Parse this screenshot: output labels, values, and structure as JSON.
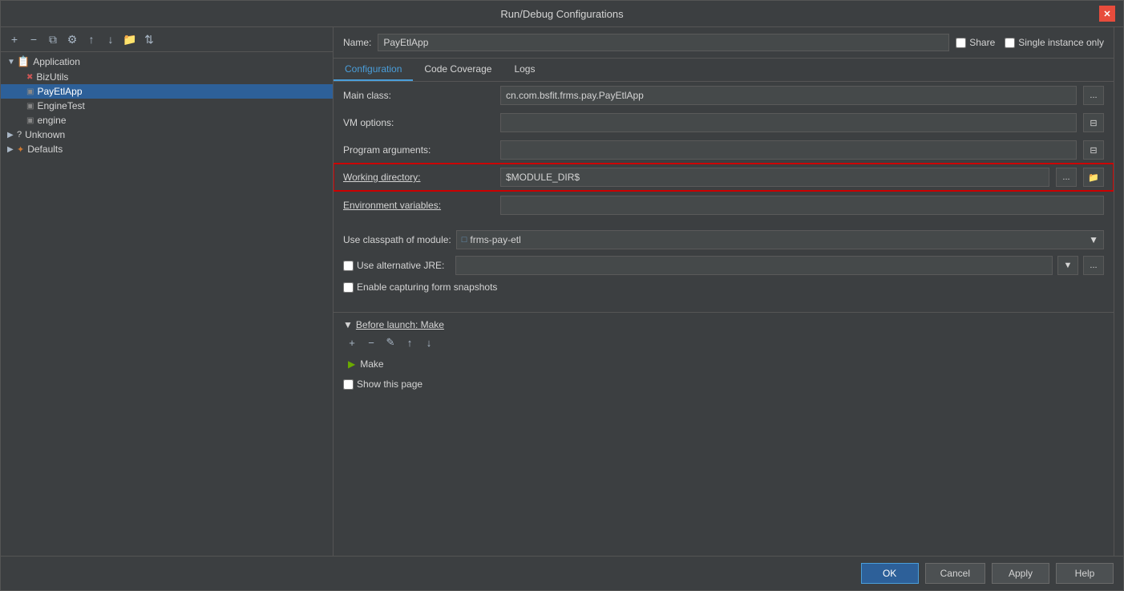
{
  "dialog": {
    "title": "Run/Debug Configurations"
  },
  "header": {
    "name_label": "Name:",
    "name_value": "PayEtlApp",
    "share_label": "Share",
    "single_instance_label": "Single instance only"
  },
  "tabs": {
    "configuration": "Configuration",
    "code_coverage": "Code Coverage",
    "logs": "Logs"
  },
  "config": {
    "main_class_label": "Main class:",
    "main_class_value": "cn.com.bsfit.frms.pay.PayEtlApp",
    "vm_options_label": "VM options:",
    "vm_options_value": "",
    "program_args_label": "Program arguments:",
    "program_args_value": "",
    "working_dir_label": "Working directory:",
    "working_dir_value": "$MODULE_DIR$",
    "env_vars_label": "Environment variables:",
    "env_vars_value": ""
  },
  "classpath": {
    "label": "Use classpath of module:",
    "value": "frms-pay-etl",
    "module_icon": "□"
  },
  "alt_jre": {
    "label": "Use alternative JRE:",
    "value": ""
  },
  "form_snapshots": {
    "label": "Enable capturing form snapshots"
  },
  "before_launch": {
    "header": "Before launch: Make",
    "items": [
      {
        "icon": "make",
        "label": "Make"
      }
    ]
  },
  "show_page": {
    "label": "Show this page"
  },
  "buttons": {
    "ok": "OK",
    "cancel": "Cancel",
    "apply": "Apply",
    "help": "Help"
  },
  "tree": {
    "add_icon": "+",
    "remove_icon": "−",
    "copy_icon": "⧉",
    "settings_icon": "⚙",
    "up_icon": "↑",
    "down_icon": "↓",
    "new_folder_icon": "📁",
    "sort_icon": "⇅",
    "items": [
      {
        "id": "application",
        "label": "Application",
        "level": 0,
        "type": "group",
        "expanded": true
      },
      {
        "id": "bizutils",
        "label": "BizUtils",
        "level": 1,
        "type": "app",
        "expanded": false
      },
      {
        "id": "payetlapp",
        "label": "PayEtlApp",
        "level": 1,
        "type": "app",
        "expanded": false,
        "selected": true
      },
      {
        "id": "enginetest",
        "label": "EngineTest",
        "level": 1,
        "type": "app",
        "expanded": false
      },
      {
        "id": "engine",
        "label": "engine",
        "level": 1,
        "type": "app",
        "expanded": false
      },
      {
        "id": "unknown",
        "label": "Unknown",
        "level": 0,
        "type": "unknown",
        "expanded": false
      },
      {
        "id": "defaults",
        "label": "Defaults",
        "level": 0,
        "type": "defaults",
        "expanded": false
      }
    ]
  },
  "icons": {
    "close": "✕",
    "arrow_right": "▶",
    "arrow_down": "▼",
    "chevron_down": "▼",
    "dots": "...",
    "folder": "📁",
    "edit": "✎"
  }
}
